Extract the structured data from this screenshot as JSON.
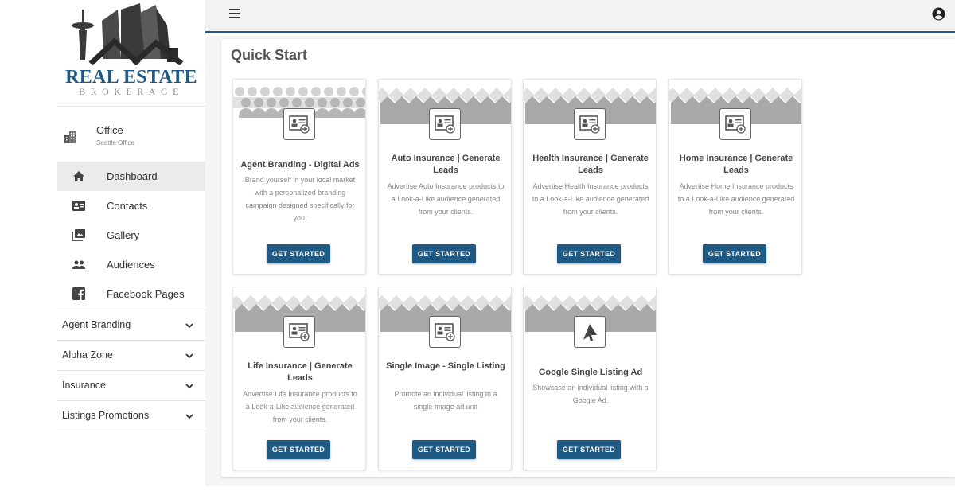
{
  "brand": {
    "title": "REAL ESTATE",
    "subtitle": "BROKERAGE",
    "title_color": "#1e5a84"
  },
  "office": {
    "icon": "building-icon",
    "name": "Office",
    "sub": "Seattle Office"
  },
  "nav": {
    "items": [
      {
        "label": "Dashboard",
        "icon": "home-icon",
        "active": true
      },
      {
        "label": "Contacts",
        "icon": "contact-card-icon"
      },
      {
        "label": "Gallery",
        "icon": "photo-library-icon"
      },
      {
        "label": "Audiences",
        "icon": "people-icon"
      },
      {
        "label": "Facebook Pages",
        "icon": "facebook-icon"
      }
    ]
  },
  "accordion": [
    {
      "label": "Agent Branding"
    },
    {
      "label": "Alpha Zone"
    },
    {
      "label": "Insurance"
    },
    {
      "label": "Listings Promotions"
    }
  ],
  "topbar": {
    "menu_icon": "hamburger-menu-icon",
    "account_icon": "account-circle-icon",
    "accent_color": "#1e5a84"
  },
  "main": {
    "section_title": "Quick Start",
    "cards": [
      {
        "title": "Agent Branding - Digital Ads",
        "desc": "Brand yourself in your local market with a personalized branding campaign designed specifically for you.",
        "button": "GET STARTED",
        "icon": "contact-card-add-icon",
        "banner": "people"
      },
      {
        "title": "Auto Insurance | Generate Leads",
        "desc": "Advertise Auto Insurance products to a Look-a-Like audience generated from your clients.",
        "button": "GET STARTED",
        "icon": "contact-card-add-icon",
        "banner": "houses"
      },
      {
        "title": "Health Insurance | Generate Leads",
        "desc": "Advertise Health Insurance products to a Look-a-Like audience generated from your clients.",
        "button": "GET STARTED",
        "icon": "contact-card-add-icon",
        "banner": "houses"
      },
      {
        "title": "Home Insurance | Generate Leads",
        "desc": "Advertise Home Insurance products to a Look-a-Like audience generated from your clients.",
        "button": "GET STARTED",
        "icon": "contact-card-add-icon",
        "banner": "houses"
      },
      {
        "title": "Life Insurance | Generate Leads",
        "desc": "Advertise Life Insurance products to a Look-a-Like audience generated from your clients.",
        "button": "GET STARTED",
        "icon": "contact-card-add-icon",
        "banner": "houses"
      },
      {
        "title": "Single Image - Single Listing",
        "desc": "Promote an individual listing in a single-image ad unit",
        "button": "GET STARTED",
        "icon": "contact-card-add-icon",
        "banner": "houses"
      },
      {
        "title": "Google Single Listing Ad",
        "desc": "Showcase an individual listing with a Google Ad.",
        "button": "GET STARTED",
        "icon": "cursor-arrow-icon",
        "banner": "houses"
      }
    ]
  }
}
